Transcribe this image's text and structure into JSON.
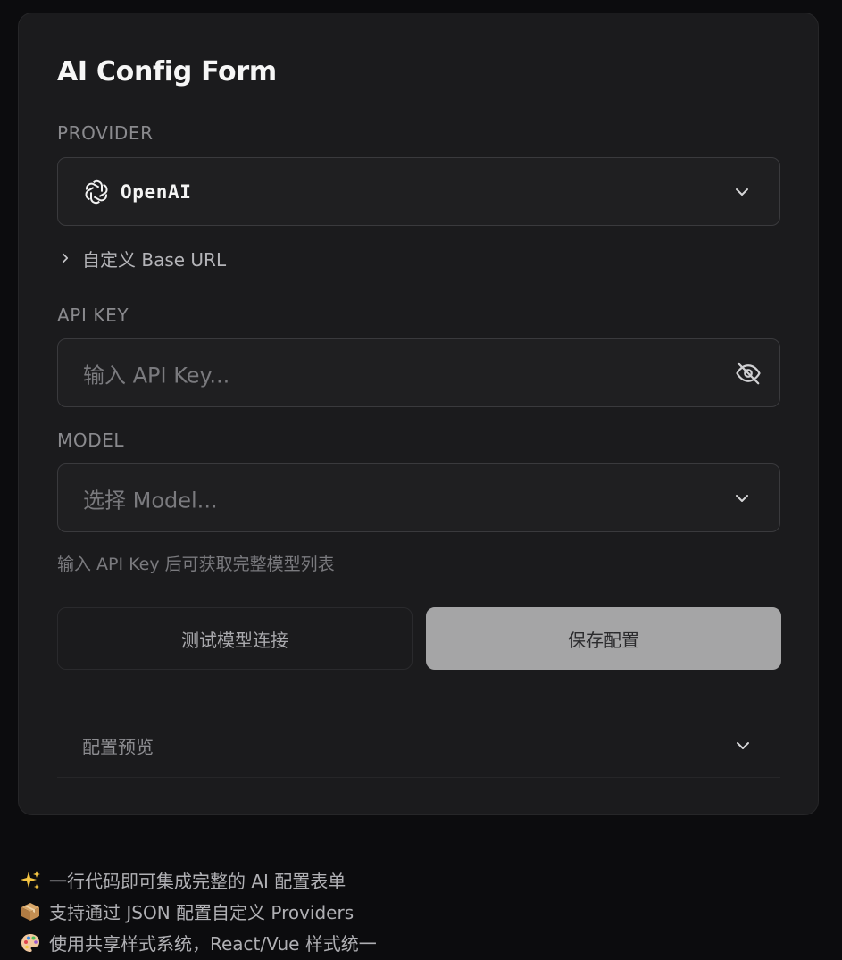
{
  "form": {
    "title": "AI Config Form",
    "provider": {
      "label": "PROVIDER",
      "selected": "OpenAI",
      "icon": "openai-logo-icon"
    },
    "base_url_toggle": "自定义 Base URL",
    "api_key": {
      "label": "API KEY",
      "placeholder": "输入 API Key...",
      "icon": "eye-off-icon"
    },
    "model": {
      "label": "MODEL",
      "placeholder": "选择 Model...",
      "hint": "输入 API Key 后可获取完整模型列表"
    },
    "buttons": {
      "test": "测试模型连接",
      "save": "保存配置"
    },
    "preview": {
      "label": "配置预览"
    }
  },
  "features": [
    {
      "icon": "sparkles-icon",
      "text": "一行代码即可集成完整的 AI 配置表单"
    },
    {
      "icon": "package-icon",
      "text": "支持通过 JSON 配置自定义 Providers"
    },
    {
      "icon": "palette-icon",
      "text": "使用共享样式系统，React/Vue 样式统一"
    }
  ],
  "colors": {
    "background": "#0c0c0e",
    "card": "#1b1b1d",
    "save_button": "#a5a5a6"
  }
}
